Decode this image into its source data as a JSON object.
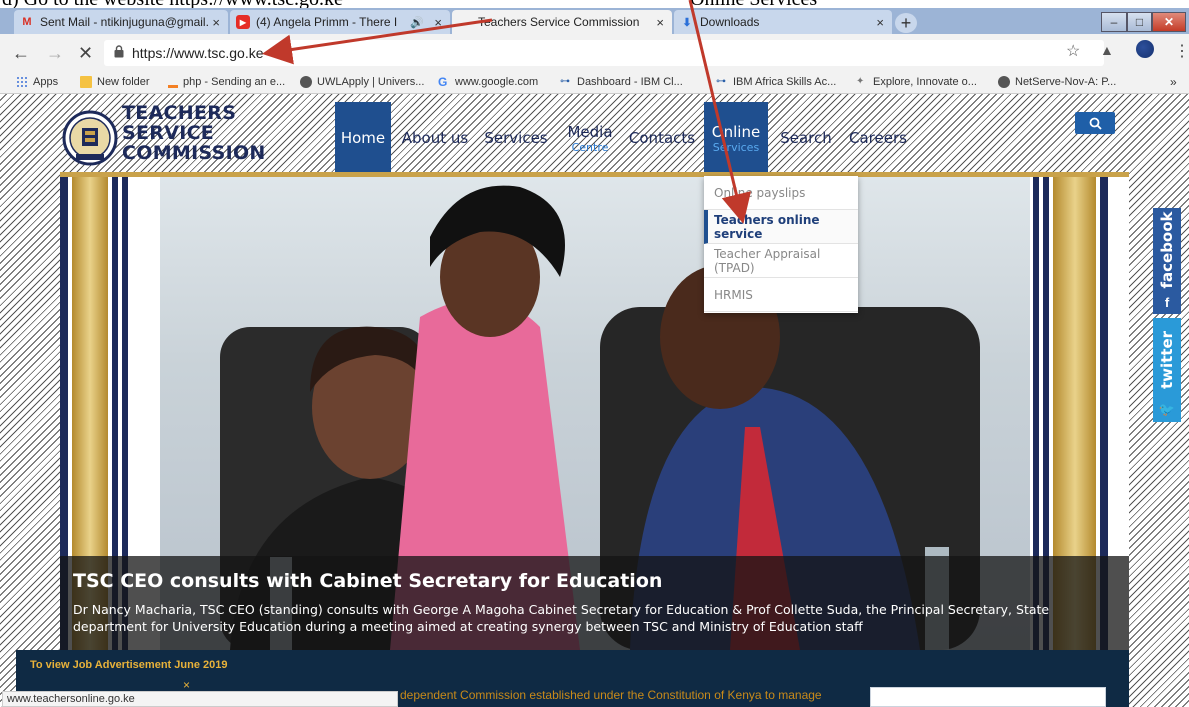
{
  "annotation": {
    "fragment_left": "d) Go to the website https://www.tsc.go.ke",
    "fragment_right": "Online Services"
  },
  "tabs": [
    {
      "title": "Sent Mail - ntikinjuguna@gmail.",
      "icon": "gmail-icon",
      "close": "×"
    },
    {
      "title": "(4) Angela Primm - There I",
      "icon": "youtube-icon",
      "close": "×"
    },
    {
      "title": "Teachers Service Commission",
      "icon": "tsc-icon",
      "close": "×"
    },
    {
      "title": "Downloads",
      "icon": "download-icon",
      "close": "×"
    }
  ],
  "newtab": "+",
  "window": {
    "min": "–",
    "max": "□",
    "close": "✕"
  },
  "address": {
    "url": "https://www.tsc.go.ke"
  },
  "bookmarks": [
    {
      "label": "Apps"
    },
    {
      "label": "New folder"
    },
    {
      "label": "php - Sending an e..."
    },
    {
      "label": "UWLApply | Univers..."
    },
    {
      "label": "www.google.com"
    },
    {
      "label": "Dashboard - IBM Cl..."
    },
    {
      "label": "IBM Africa Skills Ac..."
    },
    {
      "label": "Explore, Innovate o..."
    },
    {
      "label": "NetServe-Nov-A: P..."
    }
  ],
  "bookmarks_more": "»",
  "site": {
    "brand": [
      "TEACHERS",
      "SERVICE",
      "COMMISSION"
    ],
    "nav": [
      {
        "label": "Home",
        "sub": ""
      },
      {
        "label": "About us",
        "sub": ""
      },
      {
        "label": "Services",
        "sub": ""
      },
      {
        "label": "Media",
        "sub": "Centre"
      },
      {
        "label": "Contacts",
        "sub": ""
      },
      {
        "label": "Online",
        "sub": "Services"
      },
      {
        "label": "Search",
        "sub": ""
      },
      {
        "label": "Careers",
        "sub": ""
      }
    ],
    "search_icon": "🔍"
  },
  "dropdown": [
    {
      "label": "Online payslips"
    },
    {
      "label": "Teachers online service"
    },
    {
      "label": "Teacher Appraisal (TPAD)"
    },
    {
      "label": "HRMIS"
    }
  ],
  "hero": {
    "title": "TSC CEO consults with Cabinet Secretary for Education",
    "text": "Dr Nancy Macharia, TSC CEO (standing) consults with George A Magoha Cabinet Secretary for Education & Prof Collette Suda, the Principal Secretary, State department for University Education during a meeting aimed at creating synergy between TSC and Ministry of Education staff"
  },
  "job": {
    "text": "To view Job Advertisement June 2019",
    "close": "×"
  },
  "intro": "dependent Commission established under the Constitution of Kenya to manage",
  "status": "www.teachersonline.go.ke",
  "social": {
    "facebook": "facebook",
    "facebook_icon": "f",
    "twitter": "twitter",
    "twitter_icon": "🐦"
  },
  "colors": {
    "brand_navy": "#1d2a5a",
    "nav_blue": "#1f4f8f",
    "gold": "#c9a24a",
    "annotation_red": "#c0392b"
  }
}
